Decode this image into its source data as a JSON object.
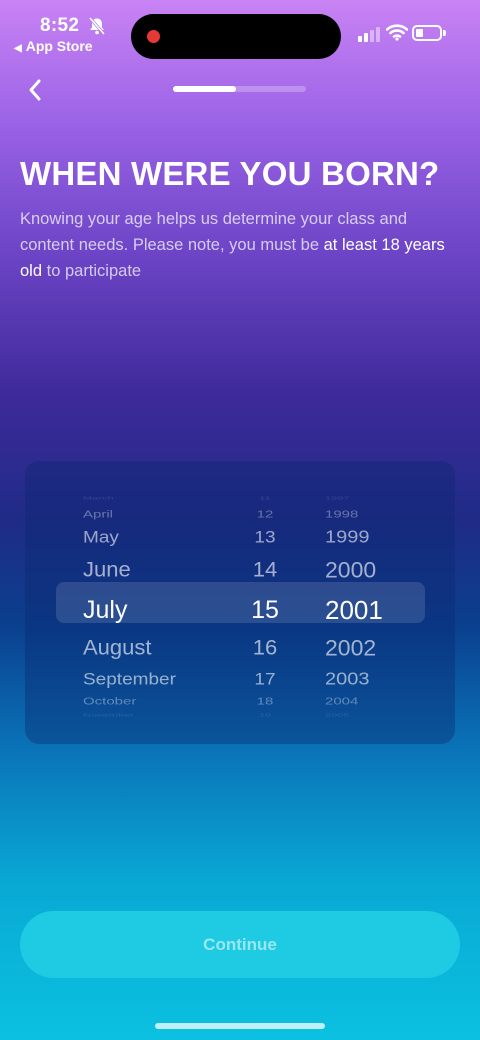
{
  "status_bar": {
    "time": "8:52",
    "back_app": "App Store",
    "battery_level": 0.3
  },
  "nav": {
    "progress": 0.47
  },
  "heading": {
    "title": "WHEN WERE YOU BORN?",
    "desc_part1": "Knowing your age helps us determine your class and content needs. Please note, you must be ",
    "desc_highlight1": "at least",
    "desc_part2": " ",
    "desc_highlight2": "18 years old",
    "desc_part3": " to participate"
  },
  "picker": {
    "months": [
      "March",
      "April",
      "May",
      "June",
      "July",
      "August",
      "September",
      "October",
      "November"
    ],
    "days": [
      "11",
      "12",
      "13",
      "14",
      "15",
      "16",
      "17",
      "18",
      "19"
    ],
    "years": [
      "1997",
      "1998",
      "1999",
      "2000",
      "2001",
      "2002",
      "2003",
      "2004",
      "2005"
    ],
    "selected_index": 4
  },
  "continue_label": "Continue"
}
